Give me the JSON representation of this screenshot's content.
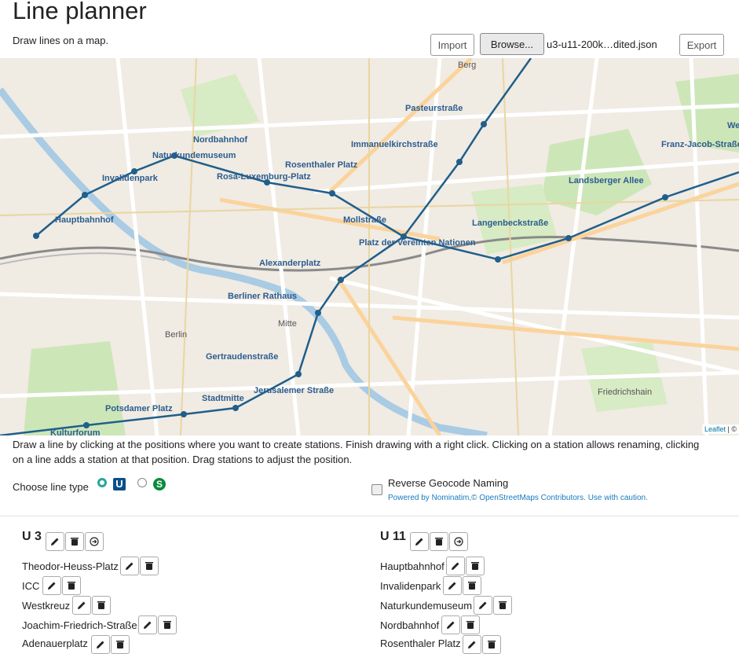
{
  "header": {
    "title": "Line planner",
    "subtitle": "Draw lines on a map."
  },
  "toolbar": {
    "import_label": "Import",
    "browse_label": "Browse...",
    "file_name": "u3-u11-200k…dited.json",
    "export_label": "Export"
  },
  "map": {
    "attribution_link": "Leaflet",
    "attribution_sep": " | ©",
    "line_color": "#1f5f8b",
    "station_labels": {
      "hbf": "Hauptbahnhof",
      "inv": "Invalidenpark",
      "nat": "Naturkundemuseum",
      "nord": "Nordbahnhof",
      "rosalux": "Rosa-Luxemburg-Platz",
      "rosenthal": "Rosenthaler Platz",
      "pasteur": "Pasteurstraße",
      "immanuel": "Immanuelkirchstraße",
      "mollstr": "Mollstraße",
      "platz": "Platz der Vereinten Nationen",
      "langenbeck": "Langenbeckstraße",
      "landsberger": "Landsberger Allee",
      "franz": "Franz-Jacob-Straße",
      "alex": "Alexanderplatz",
      "rathaus": "Berliner Rathaus",
      "gertraud": "Gertraudenstraße",
      "stadtmitte": "Stadtmitte",
      "jerusalem": "Jerusalemer Straße",
      "potsdamer": "Potsdamer Platz",
      "kultur": "Kulturforum",
      "we": "We"
    },
    "area_labels": {
      "mitte": "Mitte",
      "berlin": "Berlin",
      "friedrichshain": "Friedrichshain",
      "berg": "Berg"
    }
  },
  "help_text": "Draw a line by clicking at the positions where you want to create stations. Finish drawing with a right click. Clicking on a station allows renaming, clicking on a line adds a station at that position. Drag stations to adjust the position.",
  "line_type": {
    "label": "Choose line type",
    "u_badge": "U",
    "s_badge": "S",
    "accent": "#26a69a"
  },
  "geocode": {
    "label": "Reverse Geocode Naming",
    "powered": "Powered by Nominatim,© OpenStreetMaps Contributors. Use with caution."
  },
  "lines": [
    {
      "name": "U 3",
      "stations": [
        "Theodor-Heuss-Platz",
        "ICC",
        "Westkreuz",
        "Joachim-Friedrich-Straße",
        "Adenauerplatz"
      ]
    },
    {
      "name": "U 11",
      "stations": [
        "Hauptbahnhof",
        "Invalidenpark",
        "Naturkundemuseum",
        "Nordbahnhof",
        "Rosenthaler Platz"
      ]
    }
  ]
}
